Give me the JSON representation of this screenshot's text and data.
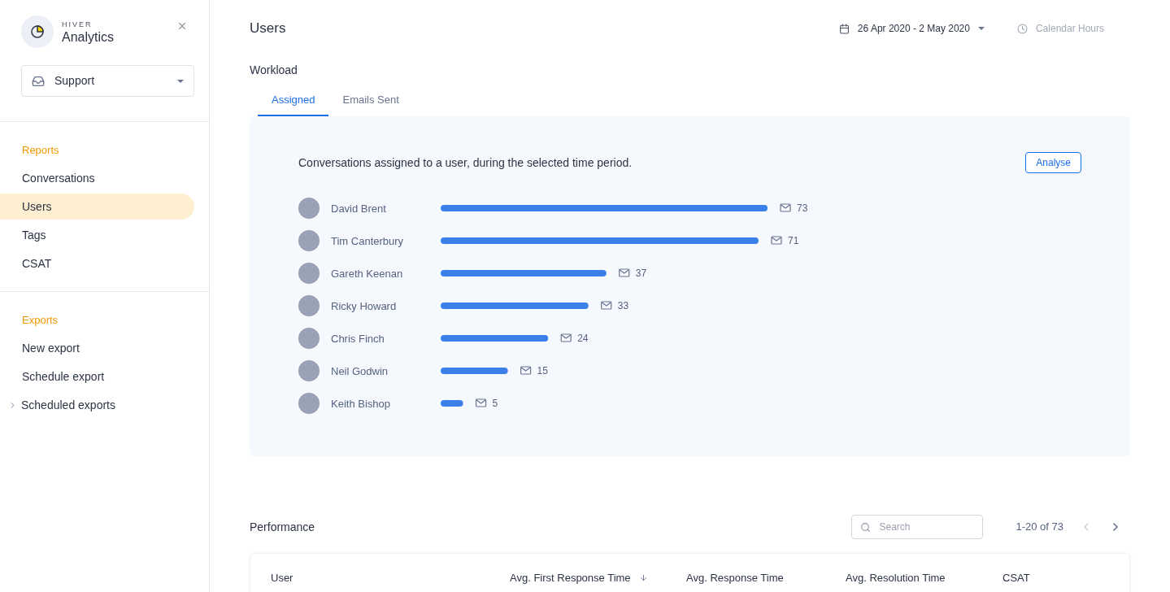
{
  "sidebar": {
    "brand_small": "HIVER",
    "brand": "Analytics",
    "inbox_select": {
      "value": "Support"
    },
    "sections": [
      {
        "title": "Reports",
        "items": [
          {
            "label": "Conversations",
            "selected": false
          },
          {
            "label": "Users",
            "selected": true
          },
          {
            "label": "Tags",
            "selected": false
          },
          {
            "label": "CSAT",
            "selected": false
          }
        ]
      },
      {
        "title": "Exports",
        "items": [
          {
            "label": "New export",
            "selected": false
          },
          {
            "label": "Schedule export",
            "selected": false
          },
          {
            "label": "Scheduled exports",
            "selected": false,
            "expandable": true
          }
        ]
      }
    ]
  },
  "header": {
    "title": "Users",
    "date_range": "26 Apr 2020 - 2 May 2020",
    "hours": {
      "label": "Calendar Hours",
      "disabled": true
    }
  },
  "workload": {
    "title": "Workload",
    "tabs": [
      {
        "label": "Assigned",
        "selected": true
      },
      {
        "label": "Emails Sent",
        "selected": false
      }
    ],
    "description": "Conversations assigned to a user, during the selected time period.",
    "analyse_button": "Analyse",
    "chart_data": {
      "type": "bar",
      "orientation": "horizontal",
      "data_labels": true,
      "categories": [
        "David Brent",
        "Tim Canterbury",
        "Gareth Keenan",
        "Ricky Howard",
        "Chris Finch",
        "Neil Godwin",
        "Keith Bishop"
      ],
      "series": [
        {
          "color": "#3b80e8",
          "values": [
            73,
            71,
            37,
            33,
            24,
            15,
            5
          ]
        }
      ]
    }
  },
  "performance": {
    "title": "Performance",
    "search": {
      "placeholder": "Search"
    },
    "pagination": {
      "range": "1-20 of 73",
      "prev_disabled": true,
      "next_disabled": false
    },
    "columns": [
      {
        "label": "User",
        "sorted": false
      },
      {
        "label": "Avg. First Response Time",
        "sorted": true
      },
      {
        "label": "Avg. Response Time",
        "sorted": false
      },
      {
        "label": "Avg. Resolution Time",
        "sorted": false
      },
      {
        "label": "CSAT",
        "sorted": false
      }
    ]
  }
}
